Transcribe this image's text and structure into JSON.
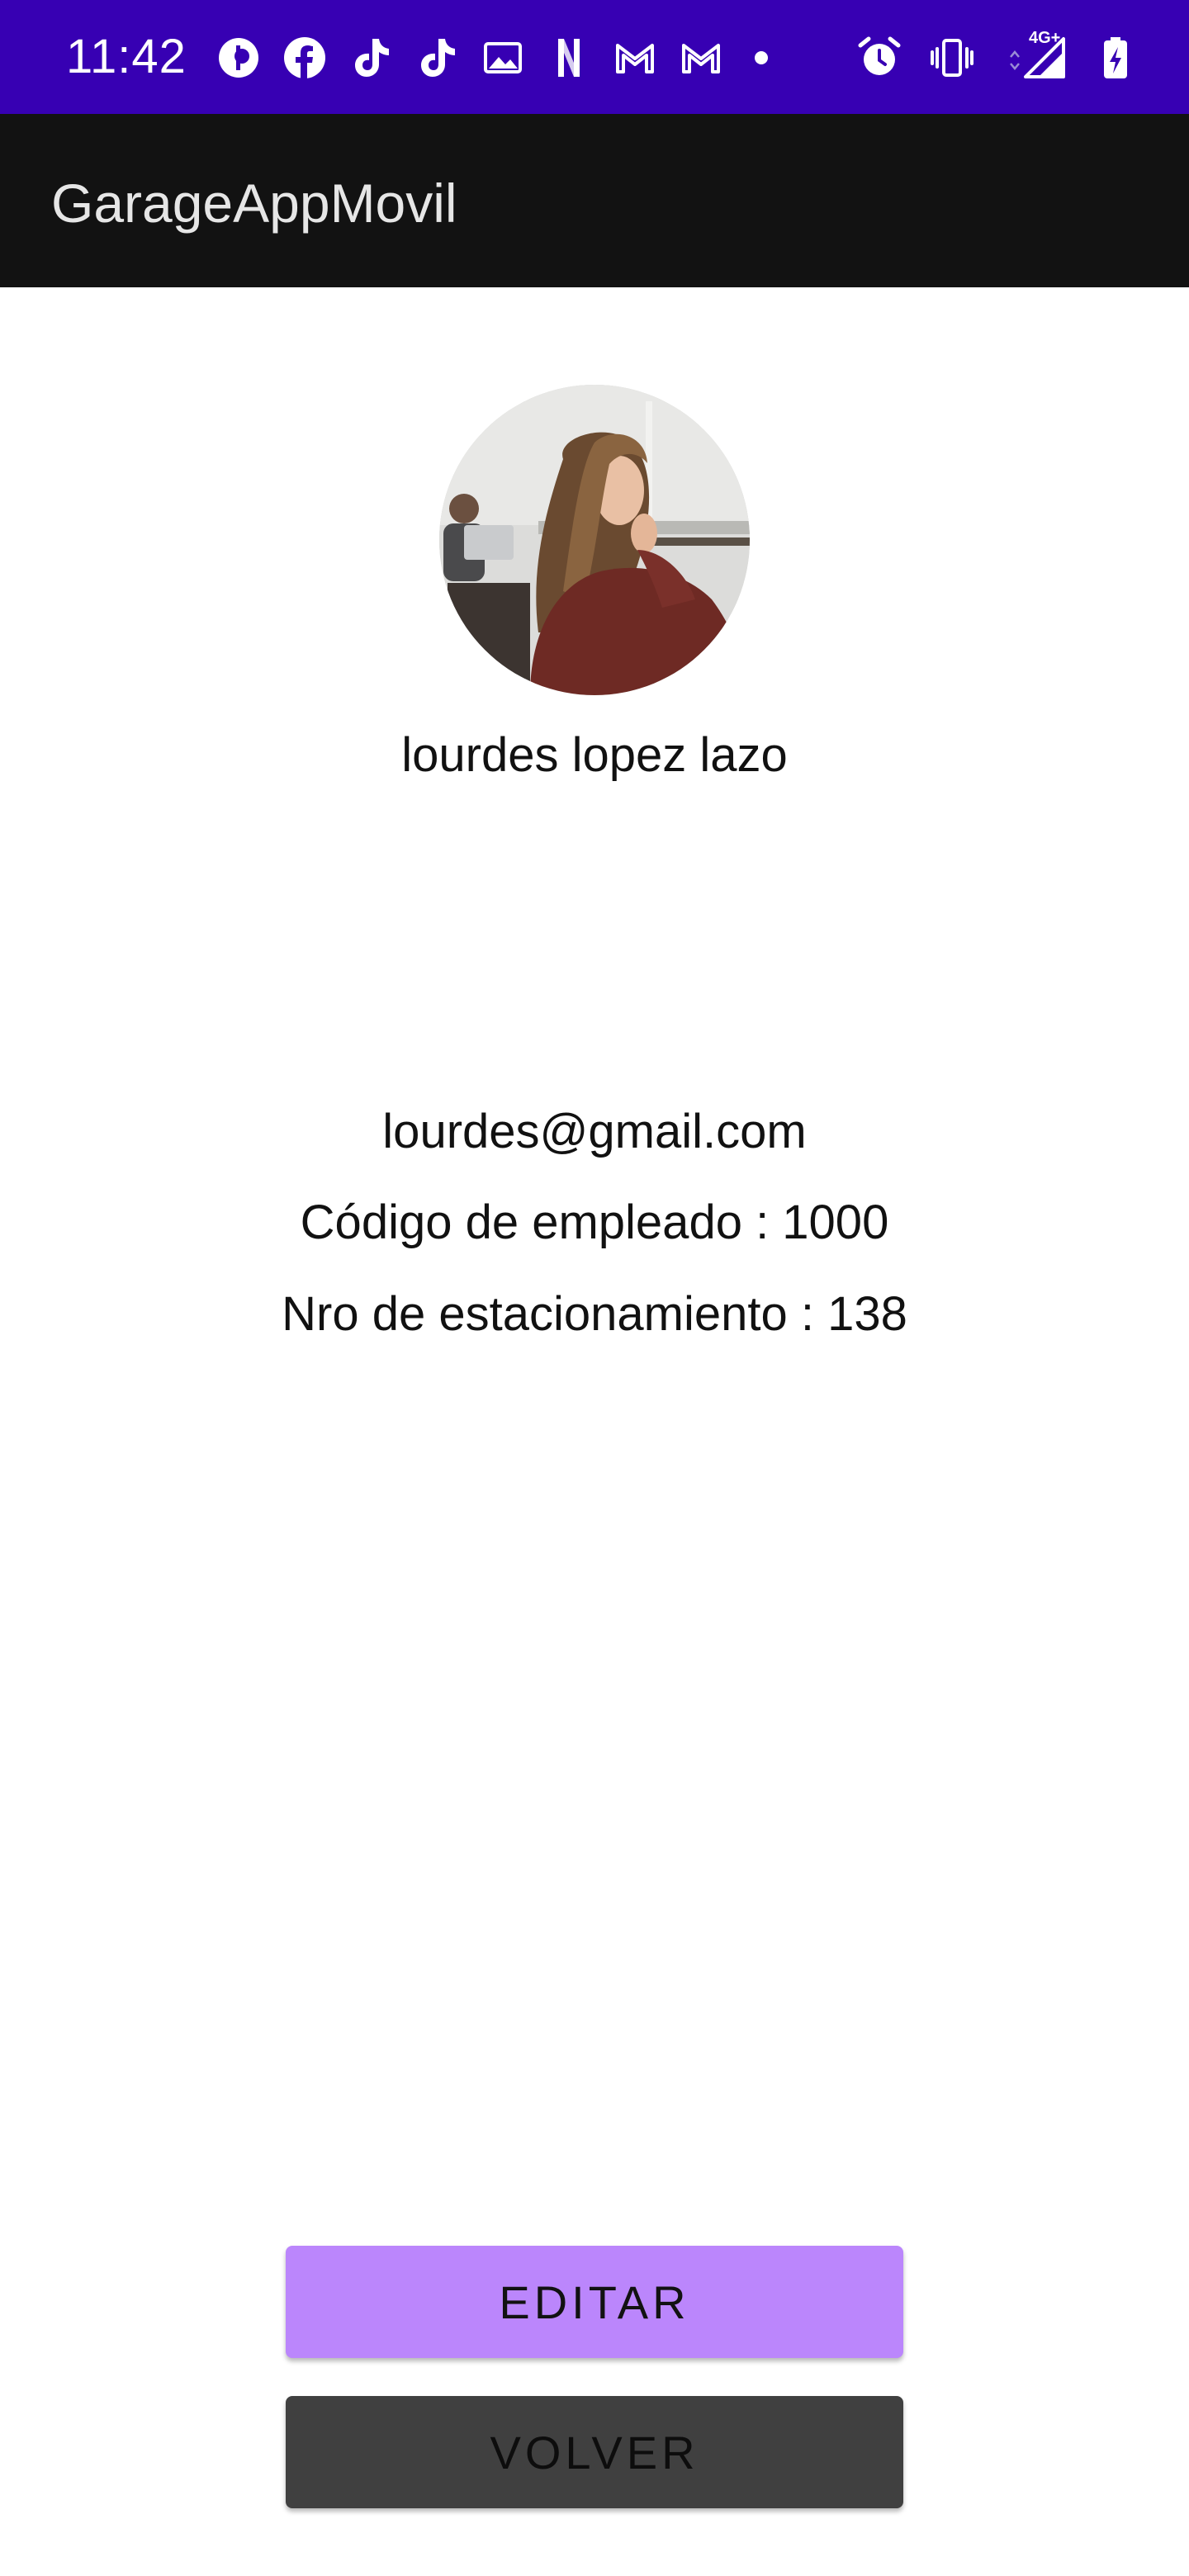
{
  "status_bar": {
    "time": "11:42",
    "network_label": "4G+",
    "icons_left": [
      "opera-icon",
      "facebook-icon",
      "tiktok-icon",
      "tiktok-icon",
      "gallery-icon",
      "netflix-icon",
      "gmail-icon",
      "gmail-icon",
      "dot-icon"
    ],
    "icons_right": [
      "alarm-icon",
      "vibrate-icon",
      "signal-4g-icon",
      "battery-charging-icon"
    ],
    "background_color": "#3700b3"
  },
  "app_bar": {
    "title": "GarageAppMovil",
    "background_color": "#121212"
  },
  "profile": {
    "name": "lourdes lopez lazo",
    "email": "lourdes@gmail.com",
    "employee_code": "Código de empleado : 1000",
    "parking_number": "Nro de estacionamiento : 138"
  },
  "buttons": {
    "edit_label": "EDITAR",
    "edit_color": "#bb86fc",
    "back_label": "VOLVER",
    "back_color": "#404040"
  }
}
